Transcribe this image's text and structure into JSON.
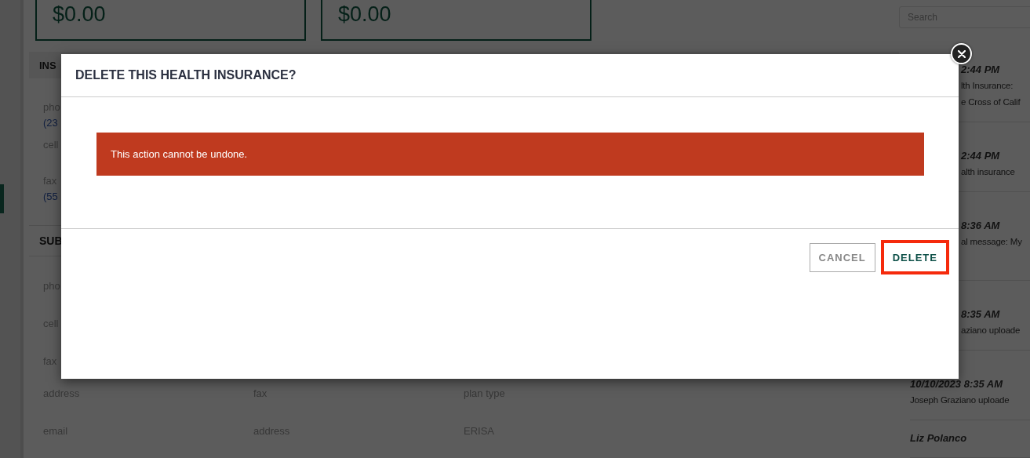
{
  "summary_cards": [
    {
      "amount": "$0.00"
    },
    {
      "amount": "$0.00"
    }
  ],
  "insurance_section": {
    "heading": "INS",
    "fields": [
      {
        "label": "pho",
        "value": "(23"
      },
      {
        "label": "cell"
      },
      {
        "label": "fax",
        "value": "(55"
      }
    ]
  },
  "subscriber_section": {
    "heading": "SUB",
    "fields": [
      {
        "label": "pho"
      },
      {
        "label": "cell"
      },
      {
        "label": "fax"
      }
    ],
    "grid": [
      [
        "address",
        "fax",
        "plan type"
      ],
      [
        "email",
        "address",
        "ERISA"
      ]
    ]
  },
  "search": {
    "placeholder": "Search"
  },
  "activity": [
    {
      "kind": "partial",
      "date": "2:44 PM",
      "lines": [
        "lth Insurance:",
        "e Cross of Calif"
      ]
    },
    {
      "kind": "partial",
      "date": "2:44 PM",
      "lines": [
        "alth insurance"
      ]
    },
    {
      "kind": "partial",
      "date": "8:36 AM",
      "lines": [
        "al message: My"
      ]
    },
    {
      "kind": "partial",
      "date": "8:35 AM",
      "lines": [
        "aziano uploade"
      ]
    },
    {
      "kind": "full",
      "date": "10/10/2023 8:35 AM",
      "lines": [
        "Joseph Graziano uploade"
      ]
    },
    {
      "kind": "full",
      "author": "Liz Polanco"
    }
  ],
  "dialog": {
    "title": "DELETE THIS HEALTH INSURANCE?",
    "alert": "This action cannot be undone.",
    "buttons": [
      {
        "label": "CANCEL",
        "kind": "secondary",
        "highlighted": false
      },
      {
        "label": "DELETE",
        "kind": "primary",
        "highlighted": true
      }
    ]
  }
}
